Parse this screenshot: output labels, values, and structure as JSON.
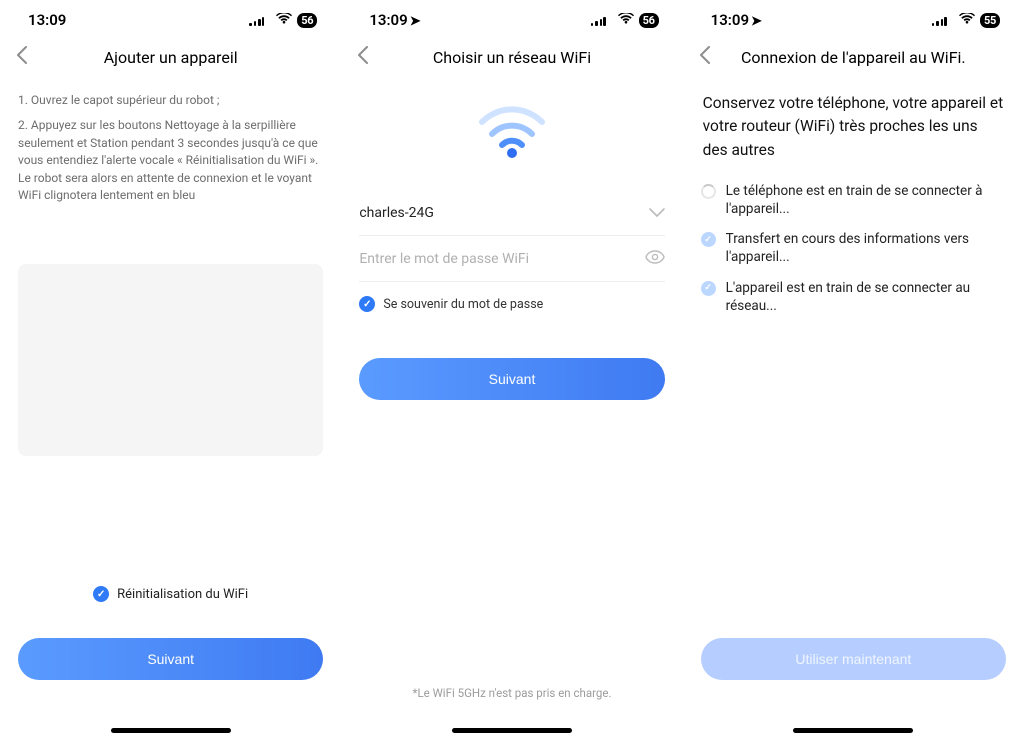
{
  "screens": [
    {
      "status": {
        "time": "13:09",
        "location_arrow": false,
        "battery": "56"
      },
      "nav": {
        "title": "Ajouter un appareil"
      },
      "instructions": [
        "1. Ouvrez le capot supérieur du robot ;",
        "2. Appuyez sur les boutons Nettoyage à la serpillière seulement et Station pendant 3 secondes jusqu'à ce que vous entendiez l'alerte vocale « Réinitialisation du WiFi ». Le robot sera alors en attente de connexion et le voyant WiFi clignotera lentement en bleu"
      ],
      "confirm_label": "Réinitialisation du WiFi",
      "primary_button": "Suivant"
    },
    {
      "status": {
        "time": "13:09",
        "location_arrow": true,
        "battery": "56"
      },
      "nav": {
        "title": "Choisir un réseau WiFi"
      },
      "ssid_value": "charles-24G",
      "password_placeholder": "Entrer le mot de passe WiFi",
      "remember_label": "Se souvenir du mot de passe",
      "primary_button": "Suivant",
      "footnote": "*Le WiFi 5GHz n'est pas pris en charge."
    },
    {
      "status": {
        "time": "13:09",
        "location_arrow": true,
        "battery": "55"
      },
      "nav": {
        "title": "Connexion de l'appareil au WiFi."
      },
      "heading": "Conservez votre téléphone, votre appareil et votre routeur (WiFi) très proches les uns des autres",
      "steps": [
        {
          "state": "spinner",
          "text": "Le téléphone est en train de se connecter à l'appareil..."
        },
        {
          "state": "done",
          "text": "Transfert en cours des informations vers l'appareil..."
        },
        {
          "state": "done",
          "text": "L'appareil est en train de se connecter au réseau..."
        }
      ],
      "primary_button": "Utiliser maintenant"
    }
  ]
}
